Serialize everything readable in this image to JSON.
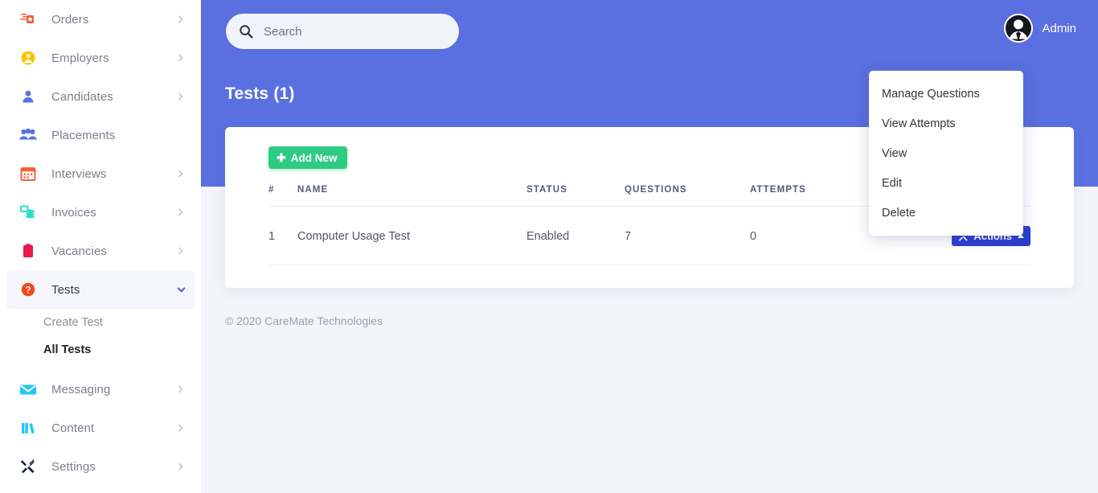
{
  "sidebar": {
    "items": [
      {
        "label": "Orders",
        "icon": "orders-icon",
        "has_chevron": true,
        "expanded": false,
        "active": false
      },
      {
        "label": "Employers",
        "icon": "employers-icon",
        "has_chevron": true,
        "expanded": false,
        "active": false
      },
      {
        "label": "Candidates",
        "icon": "candidates-icon",
        "has_chevron": true,
        "expanded": false,
        "active": false
      },
      {
        "label": "Placements",
        "icon": "placements-icon",
        "has_chevron": false,
        "expanded": false,
        "active": false
      },
      {
        "label": "Interviews",
        "icon": "interviews-icon",
        "has_chevron": true,
        "expanded": false,
        "active": false
      },
      {
        "label": "Invoices",
        "icon": "invoices-icon",
        "has_chevron": true,
        "expanded": false,
        "active": false
      },
      {
        "label": "Vacancies",
        "icon": "vacancies-icon",
        "has_chevron": true,
        "expanded": false,
        "active": false
      },
      {
        "label": "Tests",
        "icon": "tests-icon",
        "has_chevron": true,
        "expanded": true,
        "active": true
      },
      {
        "label": "Messaging",
        "icon": "messaging-icon",
        "has_chevron": true,
        "expanded": false,
        "active": false
      },
      {
        "label": "Content",
        "icon": "content-icon",
        "has_chevron": true,
        "expanded": false,
        "active": false
      },
      {
        "label": "Settings",
        "icon": "settings-icon",
        "has_chevron": true,
        "expanded": false,
        "active": false
      }
    ],
    "tests_submenu": [
      {
        "label": "Create Test",
        "current": false
      },
      {
        "label": "All Tests",
        "current": true
      }
    ]
  },
  "header": {
    "background_color": "#5a6fe0",
    "search": {
      "value": "",
      "placeholder": "Search",
      "icon": "search-icon"
    },
    "user": {
      "name": "Admin",
      "avatar": "user-avatar"
    },
    "page_title": "Tests (1)"
  },
  "card": {
    "add_new_label": "Add New",
    "add_new_plus": "✚",
    "add_new_color": "#2ecb82",
    "table": {
      "columns": [
        "#",
        "NAME",
        "STATUS",
        "QUESTIONS",
        "ATTEMPTS",
        ""
      ],
      "rows": [
        {
          "num": "1",
          "name": "Computer Usage Test",
          "status": "Enabled",
          "questions": "7",
          "attempts": "0",
          "action_label": "Actions"
        }
      ]
    }
  },
  "dropdown": {
    "open": true,
    "items": [
      {
        "label": "Manage Questions"
      },
      {
        "label": "View Attempts"
      },
      {
        "label": "View"
      },
      {
        "label": "Edit"
      },
      {
        "label": "Delete"
      }
    ]
  },
  "footer": {
    "text": "© 2020 CareMate Technologies"
  },
  "colors": {
    "header_blue": "#5a6fe0",
    "accent_green": "#2ecb82",
    "actions_blue": "#2c3fd0",
    "page_bg": "#f4f5fb"
  }
}
